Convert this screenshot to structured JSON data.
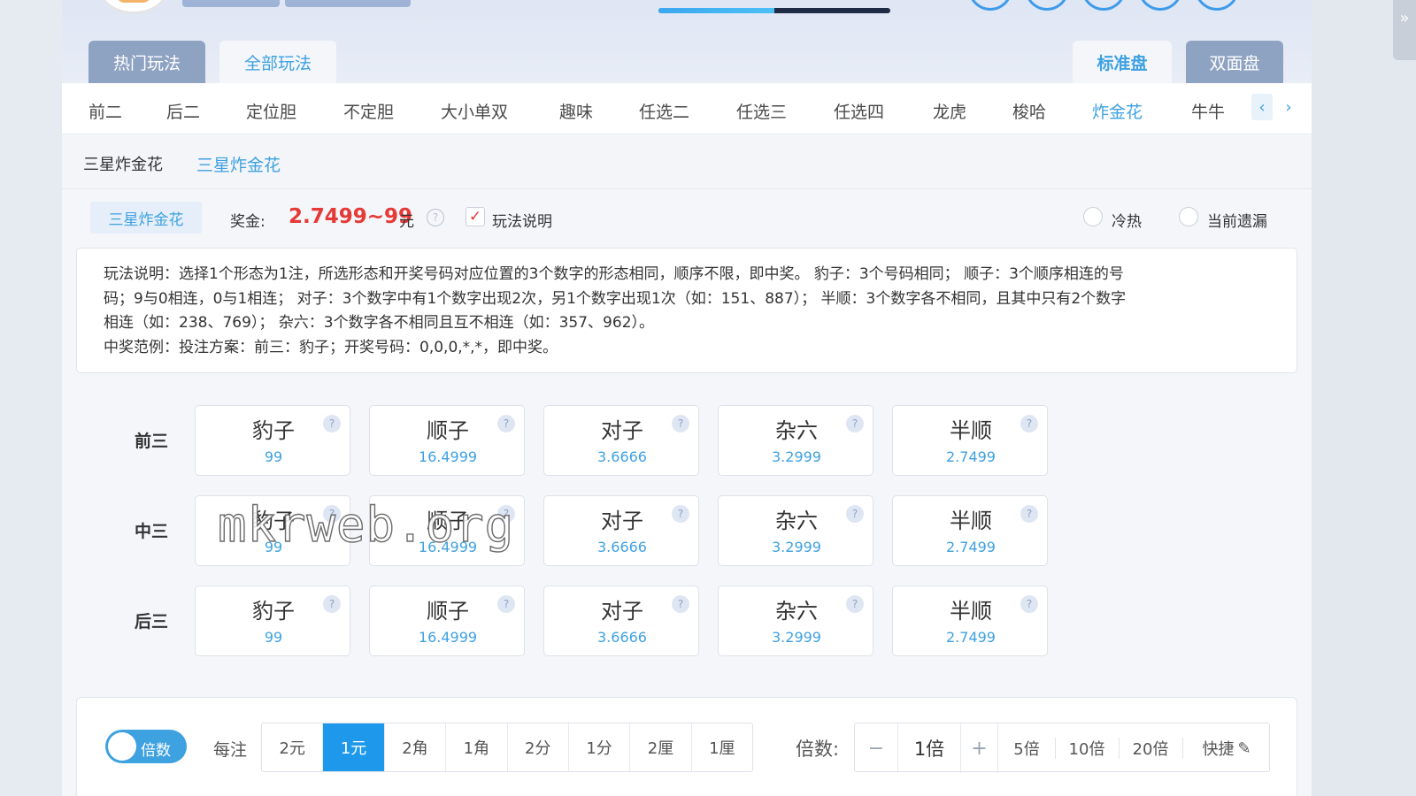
{
  "top_tabs": {
    "hot": "热门玩法",
    "all": "全部玩法",
    "standard": "标准盘",
    "double": "双面盘"
  },
  "progress": 0.5,
  "categories": [
    "前二",
    "后二",
    "定位胆",
    "不定胆",
    "大小单双",
    "趣味",
    "任选二",
    "任选三",
    "任选四",
    "龙虎",
    "梭哈",
    "炸金花",
    "牛牛"
  ],
  "active_category": "炸金花",
  "subtypes": [
    "三星炸金花",
    "三星炸金花"
  ],
  "info": {
    "play_tag": "三星炸金花",
    "bonus_label": "奖金:",
    "bonus_value": "2.7499~99",
    "bonus_unit": "元",
    "explain_label": "玩法说明",
    "explain_checked": true,
    "radio_hot_cold": "冷热",
    "radio_missing": "当前遗漏"
  },
  "description": {
    "line1": "玩法说明：选择1个形态为1注，所选形态和开奖号码对应位置的3个数字的形态相同，顺序不限，即中奖。 豹子：3个号码相同； 顺子：3个顺序相连的号",
    "line2": "码；9与0相连，0与1相连； 对子：3个数字中有1个数字出现2次，另1个数字出现1次（如：151、887）； 半顺：3个数字各不相同，且其中只有2个数字",
    "line3": "相连（如：238、769）； 杂六：3个数字各不相同且互不相连（如：357、962）。",
    "line4": "中奖范例：投注方案：前三：豹子；开奖号码：0,0,0,*,*，即中奖。"
  },
  "grid": {
    "rows": [
      {
        "label": "前三",
        "cells": [
          {
            "name": "豹子",
            "odds": "99"
          },
          {
            "name": "顺子",
            "odds": "16.4999"
          },
          {
            "name": "对子",
            "odds": "3.6666"
          },
          {
            "name": "杂六",
            "odds": "3.2999"
          },
          {
            "name": "半顺",
            "odds": "2.7499"
          }
        ]
      },
      {
        "label": "中三",
        "cells": [
          {
            "name": "豹子",
            "odds": "99"
          },
          {
            "name": "顺子",
            "odds": "16.4999"
          },
          {
            "name": "对子",
            "odds": "3.6666"
          },
          {
            "name": "杂六",
            "odds": "3.2999"
          },
          {
            "name": "半顺",
            "odds": "2.7499"
          }
        ]
      },
      {
        "label": "后三",
        "cells": [
          {
            "name": "豹子",
            "odds": "99"
          },
          {
            "name": "顺子",
            "odds": "16.4999"
          },
          {
            "name": "对子",
            "odds": "3.6666"
          },
          {
            "name": "杂六",
            "odds": "3.2999"
          },
          {
            "name": "半顺",
            "odds": "2.7499"
          }
        ]
      }
    ],
    "help_glyph": "?"
  },
  "watermark": "mkrweb.org",
  "bottom": {
    "toggle_label": "倍数",
    "per_bet_label": "每注",
    "units": [
      "2元",
      "1元",
      "2角",
      "1角",
      "2分",
      "1分",
      "2厘",
      "1厘"
    ],
    "active_unit": "1元",
    "multiplier_label": "倍数:",
    "multiplier_value": "1倍",
    "minus": "−",
    "plus": "+",
    "presets": [
      "5倍",
      "10倍",
      "20倍"
    ],
    "quick_label": "快捷",
    "quick_icon": "✎"
  },
  "colors": {
    "accent": "#3ea1e0",
    "bonus": "#e53935",
    "active_unit_bg": "#1e98ea",
    "dark_tab": "#8ea2c2"
  }
}
